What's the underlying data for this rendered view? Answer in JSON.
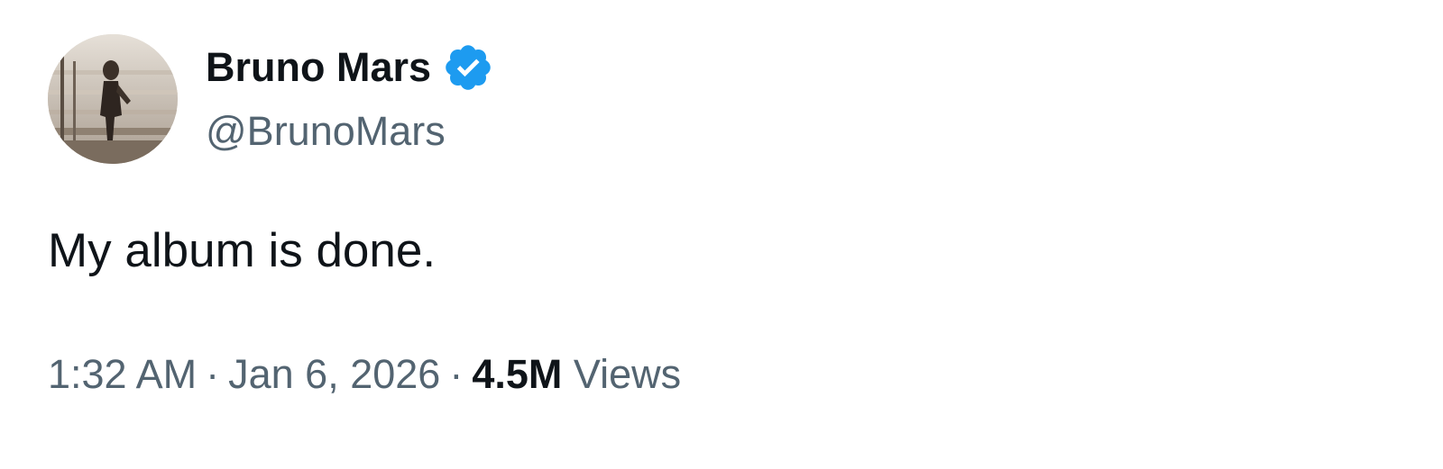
{
  "author": {
    "display_name": "Bruno Mars",
    "handle": "@BrunoMars",
    "verified": true,
    "avatar": "avatar-photo",
    "verified_icon": "verified-badge-icon"
  },
  "tweet": {
    "text": "My album is done."
  },
  "meta": {
    "time": "1:32 AM",
    "separator": "·",
    "date": "Jan 6, 2026",
    "views_count": "4.5M",
    "views_label": "Views"
  },
  "colors": {
    "primary_text": "#0f1419",
    "secondary_text": "#536471",
    "verified_blue": "#1d9bf0",
    "background": "#ffffff"
  }
}
